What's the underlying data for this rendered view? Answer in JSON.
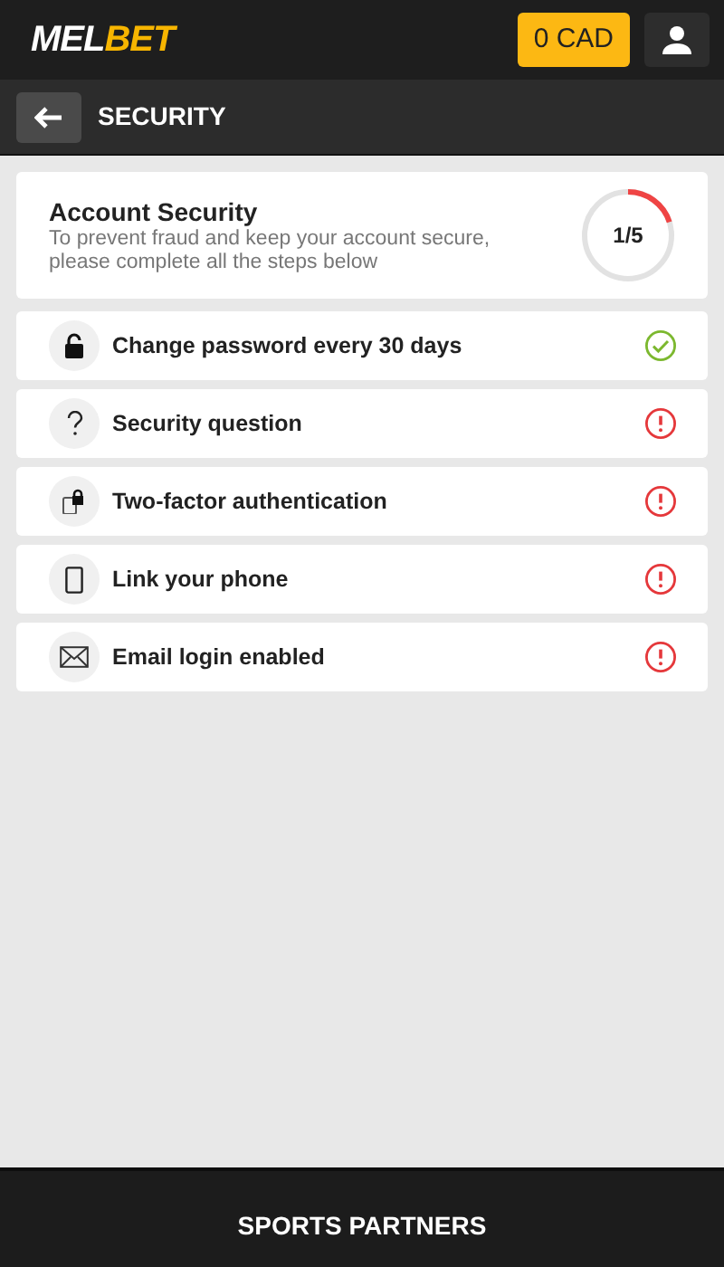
{
  "header": {
    "logo": {
      "first": "MEL",
      "second": "BET"
    },
    "balance": "0 CAD"
  },
  "title_bar": {
    "title": "SECURITY"
  },
  "summary": {
    "title": "Account Security",
    "text": "To prevent fraud and keep your account secure, please complete all the steps below",
    "progress": "1/5",
    "level": 0.2
  },
  "steps": [
    {
      "kind": "lock",
      "label": "Change password every 30 days",
      "done": true
    },
    {
      "kind": "question",
      "label": "Security question",
      "done": false
    },
    {
      "kind": "twofactor",
      "label": "Two-factor authentication",
      "done": false
    },
    {
      "kind": "phone",
      "label": "Link your phone",
      "done": false
    },
    {
      "kind": "email",
      "label": "Email login enabled",
      "done": false
    }
  ],
  "footer": {
    "title": "SPORTS PARTNERS"
  }
}
